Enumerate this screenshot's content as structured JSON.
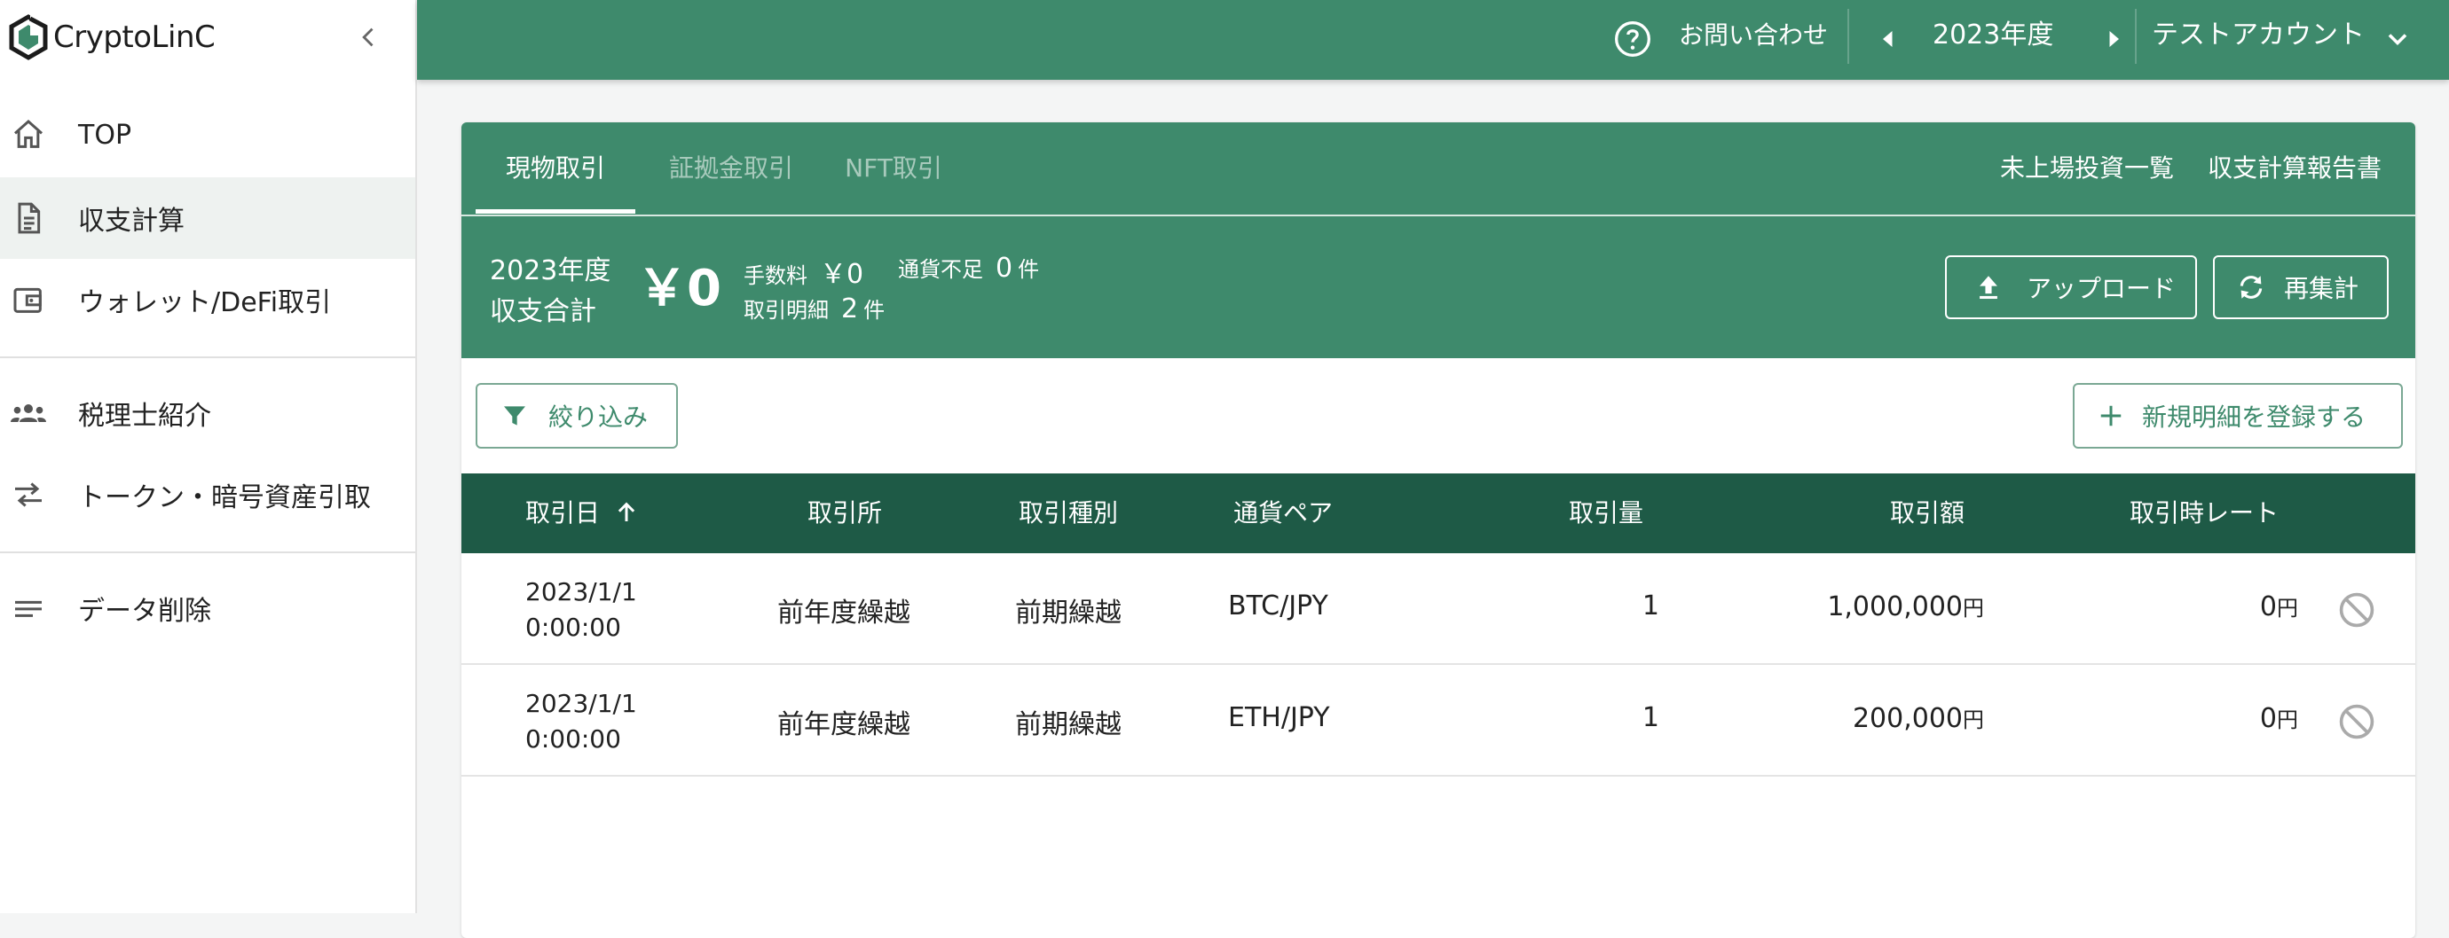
{
  "app": {
    "brand": "CryptoLinC",
    "accent": "#3e8a6c",
    "header_dark": "#1e5a46"
  },
  "sidebar": {
    "items": [
      {
        "label": "TOP",
        "icon": "home-icon"
      },
      {
        "label": "収支計算",
        "icon": "document-icon",
        "active": true
      },
      {
        "label": "ウォレット/DeFi取引",
        "icon": "wallet-icon"
      },
      {
        "label": "税理士紹介",
        "icon": "people-icon"
      },
      {
        "label": "トークン・暗号資産引取",
        "icon": "swap-icon"
      },
      {
        "label": "データ削除",
        "icon": "lines-icon"
      }
    ]
  },
  "topbar": {
    "contact": "お問い合わせ",
    "year": "2023年度",
    "account": "テストアカウント"
  },
  "tabs": [
    {
      "label": "現物取引",
      "active": true
    },
    {
      "label": "証拠金取引",
      "active": false
    },
    {
      "label": "NFT取引",
      "active": false
    }
  ],
  "head_links": {
    "unlisted": "未上場投資一覧",
    "report": "収支計算報告書"
  },
  "summary": {
    "year": "2023年度",
    "label": "収支合計",
    "total": "￥0",
    "fee_label": "手数料",
    "fee_value": "￥0",
    "shortage_label": "通貨不足",
    "shortage_value": "0",
    "shortage_unit": "件",
    "details_label": "取引明細",
    "details_value": "2",
    "details_unit": "件"
  },
  "buttons": {
    "upload": "アップロード",
    "recalc": "再集計",
    "filter": "絞り込み",
    "new_entry": "新規明細を登録する"
  },
  "table": {
    "headers": [
      "取引日",
      "取引所",
      "取引種別",
      "通貨ペア",
      "取引量",
      "取引額",
      "取引時レート"
    ],
    "sort_indicator": "↑",
    "rows": [
      {
        "date": "2023/1/1",
        "time": "0:00:00",
        "exchange": "前年度繰越",
        "type": "前期繰越",
        "pair": "BTC/JPY",
        "qty": "1",
        "amount": "1,000,000",
        "amount_unit": "円",
        "rate": "0",
        "rate_unit": "円"
      },
      {
        "date": "2023/1/1",
        "time": "0:00:00",
        "exchange": "前年度繰越",
        "type": "前期繰越",
        "pair": "ETH/JPY",
        "qty": "1",
        "amount": "200,000",
        "amount_unit": "円",
        "rate": "0",
        "rate_unit": "円"
      }
    ]
  }
}
